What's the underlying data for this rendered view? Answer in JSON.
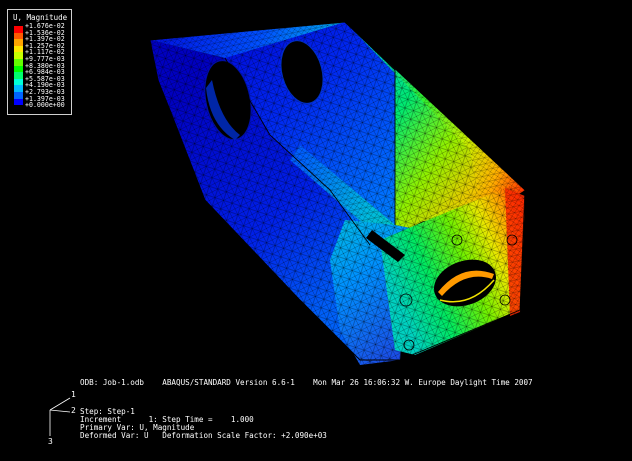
{
  "legend": {
    "title": "U, Magnitude",
    "values": [
      "+1.676e-02",
      "+1.536e-02",
      "+1.397e-02",
      "+1.257e-02",
      "+1.117e-02",
      "+9.777e-03",
      "+8.380e-03",
      "+6.984e-03",
      "+5.587e-03",
      "+4.190e-03",
      "+2.793e-03",
      "+1.397e-03",
      "+0.000e+00"
    ],
    "colors": [
      "#ff0000",
      "#ff5a00",
      "#ffa500",
      "#ffe600",
      "#c8ff00",
      "#64ff00",
      "#00ff00",
      "#00ff6e",
      "#00ffd8",
      "#00b9ff",
      "#0064ff",
      "#0000ff"
    ]
  },
  "info": {
    "odb_line": "ODB: Job-1.odb    ABAQUS/STANDARD Version 6.6-1    Mon Mar 26 16:06:32 W. Europe Daylight Time 2007",
    "step_line": "Step: Step-1",
    "increment_line": "Increment      1: Step Time =    1.000",
    "primary_var_line": "Primary Var: U, Magnitude",
    "deformed_var_line": "Deformed Var: U   Deformation Scale Factor: +2.090e+03"
  },
  "triad": {
    "axis_1": "1",
    "axis_2": "2",
    "axis_3": "3"
  },
  "model": {
    "result_variable": "U, Magnitude",
    "render_style": "contour with triangular mesh edges"
  }
}
